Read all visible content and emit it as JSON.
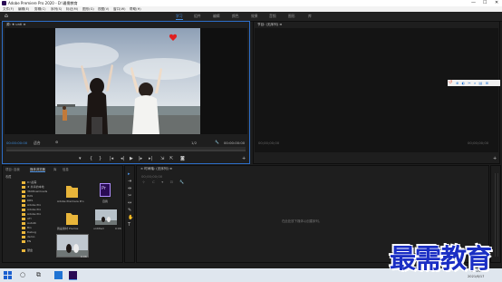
{
  "window": {
    "title": "Adobe Premiere Pro 2020 - D:\\最需教育",
    "minimize": "—",
    "maximize": "☐",
    "close": "✕"
  },
  "menu": [
    "文件(F)",
    "编辑(E)",
    "剪辑(C)",
    "序列(S)",
    "标记(M)",
    "图形(G)",
    "视图(V)",
    "窗口(W)",
    "帮助(H)"
  ],
  "workspace_tabs": [
    {
      "label": "学习",
      "active": true
    },
    {
      "label": "组件",
      "active": false
    },
    {
      "label": "编辑",
      "active": false
    },
    {
      "label": "颜色",
      "active": false
    },
    {
      "label": "效果",
      "active": false
    },
    {
      "label": "音频",
      "active": false
    },
    {
      "label": "图形",
      "active": false
    },
    {
      "label": "库",
      "active": false
    }
  ],
  "source_panel": {
    "title": "源: ★ unti ≡",
    "timecode_in": "00:00:00:00",
    "fit": "适合",
    "page": "1/2",
    "timecode_out": "00:00:00:00"
  },
  "program_panel": {
    "title": "节目: (无序列) ≡",
    "timecode_left": "00;00;00;00",
    "timecode_right": "00;00;00;00"
  },
  "project_panel": {
    "tabs": [
      "项目: 自我",
      "媒体浏览器",
      "库",
      "信息"
    ],
    "tree_header": "收藏",
    "tree": [
      "D:\\最需",
      "★ 共享的本地",
      "360Downloads",
      "DAS",
      "DRS",
      "Adobe Pro",
      "Adobe Pro",
      "Adobe Pro",
      "ATI",
      "AutoRi",
      "Bin",
      "Debug",
      "demo",
      "EN",
      "硬盘"
    ],
    "items": [
      {
        "name": "Adobe Premiere Pro",
        "type": "folder"
      },
      {
        "name": "自我",
        "type": "pr"
      },
      {
        "name": "我是素材 Premie",
        "type": "folder"
      },
      {
        "name": "untitled",
        "type": "thumb",
        "duration": "0:06"
      },
      {
        "name": "",
        "type": "thumb",
        "duration": "0:06"
      }
    ]
  },
  "timeline_panel": {
    "title": "× 时间轴: (无序列) ≡",
    "timecode": "00;00;00;00",
    "empty_message": "在此处放下媒体以创建序列。"
  },
  "taskbar": {
    "time": "15:20",
    "date": "2021/6/17"
  },
  "watermark": "最需教育",
  "colors": {
    "accent": "#3d8ad8",
    "brand_pr": "#2a0b55",
    "watermark": "#1a2ec4"
  }
}
